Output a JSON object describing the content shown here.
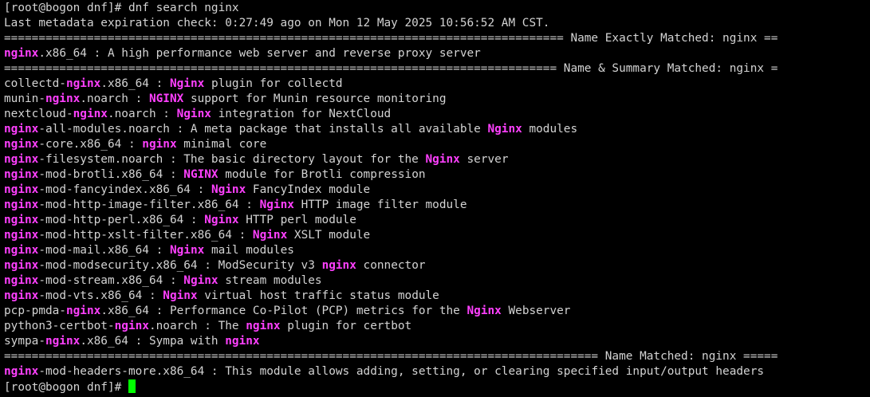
{
  "terminal": {
    "title": "dnf search nginx",
    "prompt": "[root@bogon dnf]# ",
    "command": "dnf search nginx",
    "colors": {
      "background": "#000000",
      "text": "#d3d3d3",
      "highlight": "#ff40ff",
      "cursor": "#00ff00"
    },
    "lines": [
      [
        {
          "t": "[root@bogon dnf]# dnf search nginx"
        }
      ],
      [
        {
          "t": "Last metadata expiration check: 0:27:49 ago on Mon 12 May 2025 10:56:52 AM CST."
        }
      ],
      [
        {
          "t": "================================================================================= Name Exactly Matched: nginx =="
        }
      ],
      [
        {
          "t": "nginx",
          "h": true
        },
        {
          "t": ".x86_64 : A high performance web server and reverse proxy server"
        }
      ],
      [
        {
          "t": "================================================================================ Name & Summary Matched: nginx ="
        }
      ],
      [
        {
          "t": "collectd-"
        },
        {
          "t": "nginx",
          "h": true
        },
        {
          "t": ".x86_64 : "
        },
        {
          "t": "Nginx",
          "h": true
        },
        {
          "t": " plugin for collectd"
        }
      ],
      [
        {
          "t": "munin-"
        },
        {
          "t": "nginx",
          "h": true
        },
        {
          "t": ".noarch : "
        },
        {
          "t": "NGINX",
          "h": true
        },
        {
          "t": " support for Munin resource monitoring"
        }
      ],
      [
        {
          "t": "nextcloud-"
        },
        {
          "t": "nginx",
          "h": true
        },
        {
          "t": ".noarch : "
        },
        {
          "t": "Nginx",
          "h": true
        },
        {
          "t": " integration for NextCloud"
        }
      ],
      [
        {
          "t": "nginx",
          "h": true
        },
        {
          "t": "-all-modules.noarch : A meta package that installs all available "
        },
        {
          "t": "Nginx",
          "h": true
        },
        {
          "t": " modules"
        }
      ],
      [
        {
          "t": "nginx",
          "h": true
        },
        {
          "t": "-core.x86_64 : "
        },
        {
          "t": "nginx",
          "h": true
        },
        {
          "t": " minimal core"
        }
      ],
      [
        {
          "t": "nginx",
          "h": true
        },
        {
          "t": "-filesystem.noarch : The basic directory layout for the "
        },
        {
          "t": "Nginx",
          "h": true
        },
        {
          "t": " server"
        }
      ],
      [
        {
          "t": "nginx",
          "h": true
        },
        {
          "t": "-mod-brotli.x86_64 : "
        },
        {
          "t": "NGINX",
          "h": true
        },
        {
          "t": " module for Brotli compression"
        }
      ],
      [
        {
          "t": "nginx",
          "h": true
        },
        {
          "t": "-mod-fancyindex.x86_64 : "
        },
        {
          "t": "Nginx",
          "h": true
        },
        {
          "t": " FancyIndex module"
        }
      ],
      [
        {
          "t": "nginx",
          "h": true
        },
        {
          "t": "-mod-http-image-filter.x86_64 : "
        },
        {
          "t": "Nginx",
          "h": true
        },
        {
          "t": " HTTP image filter module"
        }
      ],
      [
        {
          "t": "nginx",
          "h": true
        },
        {
          "t": "-mod-http-perl.x86_64 : "
        },
        {
          "t": "Nginx",
          "h": true
        },
        {
          "t": " HTTP perl module"
        }
      ],
      [
        {
          "t": "nginx",
          "h": true
        },
        {
          "t": "-mod-http-xslt-filter.x86_64 : "
        },
        {
          "t": "Nginx",
          "h": true
        },
        {
          "t": " XSLT module"
        }
      ],
      [
        {
          "t": "nginx",
          "h": true
        },
        {
          "t": "-mod-mail.x86_64 : "
        },
        {
          "t": "Nginx",
          "h": true
        },
        {
          "t": " mail modules"
        }
      ],
      [
        {
          "t": "nginx",
          "h": true
        },
        {
          "t": "-mod-modsecurity.x86_64 : ModSecurity v3 "
        },
        {
          "t": "nginx",
          "h": true
        },
        {
          "t": " connector"
        }
      ],
      [
        {
          "t": "nginx",
          "h": true
        },
        {
          "t": "-mod-stream.x86_64 : "
        },
        {
          "t": "Nginx",
          "h": true
        },
        {
          "t": " stream modules"
        }
      ],
      [
        {
          "t": "nginx",
          "h": true
        },
        {
          "t": "-mod-vts.x86_64 : "
        },
        {
          "t": "Nginx",
          "h": true
        },
        {
          "t": " virtual host traffic status module"
        }
      ],
      [
        {
          "t": "pcp-pmda-"
        },
        {
          "t": "nginx",
          "h": true
        },
        {
          "t": ".x86_64 : Performance Co-Pilot (PCP) metrics for the "
        },
        {
          "t": "Nginx",
          "h": true
        },
        {
          "t": " Webserver"
        }
      ],
      [
        {
          "t": "python3-certbot-"
        },
        {
          "t": "nginx",
          "h": true
        },
        {
          "t": ".noarch : The "
        },
        {
          "t": "nginx",
          "h": true
        },
        {
          "t": " plugin for certbot"
        }
      ],
      [
        {
          "t": "sympa-"
        },
        {
          "t": "nginx",
          "h": true
        },
        {
          "t": ".x86_64 : Sympa with "
        },
        {
          "t": "nginx",
          "h": true
        }
      ],
      [
        {
          "t": "====================================================================================== Name Matched: nginx ====="
        }
      ],
      [
        {
          "t": "nginx",
          "h": true
        },
        {
          "t": "-mod-headers-more.x86_64 : This module allows adding, setting, or clearing specified input/output headers"
        }
      ]
    ]
  }
}
